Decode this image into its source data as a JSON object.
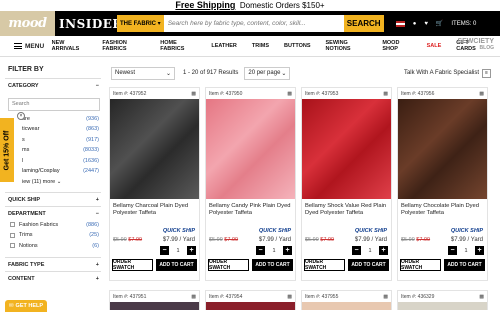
{
  "topbar": {
    "free": "Free Shipping",
    "domestic": "Domestic Orders $150+"
  },
  "header": {
    "logo": "mood",
    "insider": "INSIDER",
    "fabric_select": "THE FABRIC",
    "search_placeholder": "Search here by fabric type, content, color, skill...",
    "search_button": "SEARCH",
    "items": "ITEMS: 0"
  },
  "nav": {
    "menu": "MENU",
    "items": [
      "NEW ARRIVALS",
      "FASHION FABRICS",
      "HOME FABRICS",
      "LEATHER",
      "TRIMS",
      "BUTTONS",
      "SEWING NOTIONS",
      "MOOD SHOP",
      "SALE",
      "GIFT CARDS"
    ],
    "sew_logo": "SEWCIETY",
    "blog": "BLOG"
  },
  "sidebar": {
    "filter_by": "FILTER BY",
    "category": "CATEGORY",
    "search_placeholder": "Search",
    "categories": [
      {
        "label": "ure",
        "count": "(936)"
      },
      {
        "label": "ticwear",
        "count": "(863)"
      },
      {
        "label": "s",
        "count": "(917)"
      },
      {
        "label": "ms",
        "count": "(8033)"
      },
      {
        "label": "l",
        "count": "(1636)"
      },
      {
        "label": "laming/Cosplay",
        "count": "(2447)"
      }
    ],
    "view_more": "iew (11) more",
    "quick_ship": "QUICK SHIP",
    "department": "DEPARTMENT",
    "departments": [
      {
        "label": "Fashion Fabrics",
        "count": "(886)"
      },
      {
        "label": "Trims",
        "count": "(25)"
      },
      {
        "label": "Notions",
        "count": "(6)"
      }
    ],
    "fabric_type": "FABRIC TYPE",
    "content": "CONTENT"
  },
  "promo": {
    "off": "Get 15% Off",
    "close": "×",
    "help": "GET HELP"
  },
  "toolbar": {
    "sort": "Newest",
    "results": "1 - 20 of 917 Results",
    "per_page": "20 per page",
    "specialist": "Talk With A Fabric Specialist"
  },
  "products": [
    {
      "item": "Item #: 437952",
      "title": "Bellamy Charcoal Plain Dyed Polyester Taffeta",
      "quick": "QUICK SHIP",
      "old1": "$5.99",
      "old2": "$7.99",
      "price": "$7.99 / Yard",
      "qty": "1",
      "color": "#3a3a3a"
    },
    {
      "item": "Item #: 437950",
      "title": "Bellamy Candy Pink Plain Dyed Polyester Taffeta",
      "quick": "QUICK SHIP",
      "old1": "$5.99",
      "old2": "$7.99",
      "price": "$7.99 / Yard",
      "qty": "1",
      "color": "#e98a94"
    },
    {
      "item": "Item #: 437953",
      "title": "Bellamy Shock Value Red Plain Dyed Polyester Taffeta",
      "quick": "QUICK SHIP",
      "old1": "$5.99",
      "old2": "$7.99",
      "price": "$7.99 / Yard",
      "qty": "1",
      "color": "#c41c24"
    },
    {
      "item": "Item #: 437956",
      "title": "Bellamy Chocolate Plain Dyed Polyester Taffeta",
      "quick": "QUICK SHIP",
      "old1": "$5.99",
      "old2": "$7.99",
      "price": "$7.99 / Yard",
      "qty": "1",
      "color": "#4a2a1c"
    }
  ],
  "buttons": {
    "swatch": "ORDER SWATCH",
    "cart": "ADD TO CART",
    "minus": "−",
    "plus": "+"
  },
  "next_row": [
    "Item #: 437951",
    "Item #: 437954",
    "Item #: 437955",
    "Item #: 436329"
  ]
}
